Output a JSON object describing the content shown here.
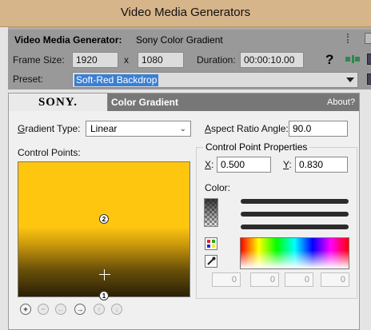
{
  "window": {
    "title": "Video Media Generators"
  },
  "header": {
    "label": "Video Media Generator:",
    "plugin_name": "Sony Color Gradient"
  },
  "frame": {
    "size_label": "Frame Size:",
    "width": "1920",
    "x_label": "x",
    "height": "1080",
    "duration_label": "Duration:",
    "duration": "00:00:10.00"
  },
  "preset": {
    "label": "Preset:",
    "value": "Soft-Red Backdrop"
  },
  "panel": {
    "brand": "SONY.",
    "tab_name": "Color Gradient",
    "about": "About",
    "about_q": "?",
    "gradient_type_label": "Gradient Type:",
    "gradient_type_value": "Linear",
    "aspect_ratio_label": "Aspect Ratio Angle:",
    "aspect_ratio_value": "90.0",
    "control_points_label": "Control Points:",
    "cpp_title": "Control Point Properties",
    "x_label": "X:",
    "x_value": "0.500",
    "y_label": "Y:",
    "y_value": "0.830",
    "color_label": "Color:",
    "rgba_values": [
      "0",
      "0",
      "0",
      "0"
    ],
    "points": [
      "2",
      "1"
    ]
  },
  "colors": {
    "gradient_top": "#ffc610",
    "gradient_bottom": "#2a2006",
    "selection": "#3a7fd3"
  }
}
